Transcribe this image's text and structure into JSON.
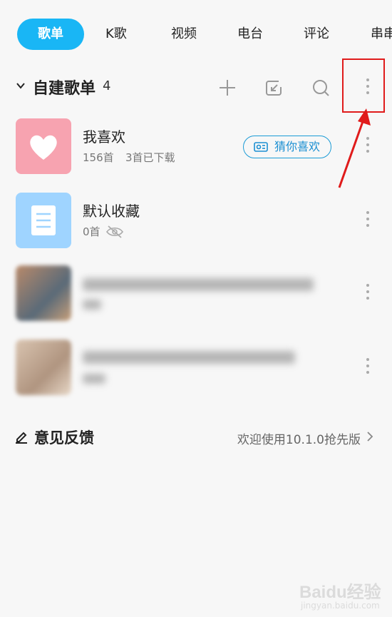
{
  "tabs": [
    {
      "label": "歌单"
    },
    {
      "label": "K歌"
    },
    {
      "label": "视频"
    },
    {
      "label": "电台"
    },
    {
      "label": "评论"
    },
    {
      "label": "串串"
    }
  ],
  "section": {
    "title": "自建歌单",
    "count": "4",
    "icons": [
      "add-icon",
      "import-icon",
      "search-icon",
      "more-icon"
    ]
  },
  "playlists": [
    {
      "title": "我喜欢",
      "meta": "156首",
      "meta2": "3首已下载",
      "action": "猜你喜欢",
      "thumb_color": "#f7a3b0"
    },
    {
      "title": "默认收藏",
      "meta": "0首",
      "thumb_color": "#9fd4ff"
    }
  ],
  "feedback": {
    "title": "意见反馈",
    "right_text": "欢迎使用10.1.0抢先版"
  },
  "watermark": {
    "brand": "Baidu经验",
    "url": "jingyan.baidu.com"
  },
  "colors": {
    "accent": "#19b6f5",
    "highlight": "#e01b1b"
  }
}
